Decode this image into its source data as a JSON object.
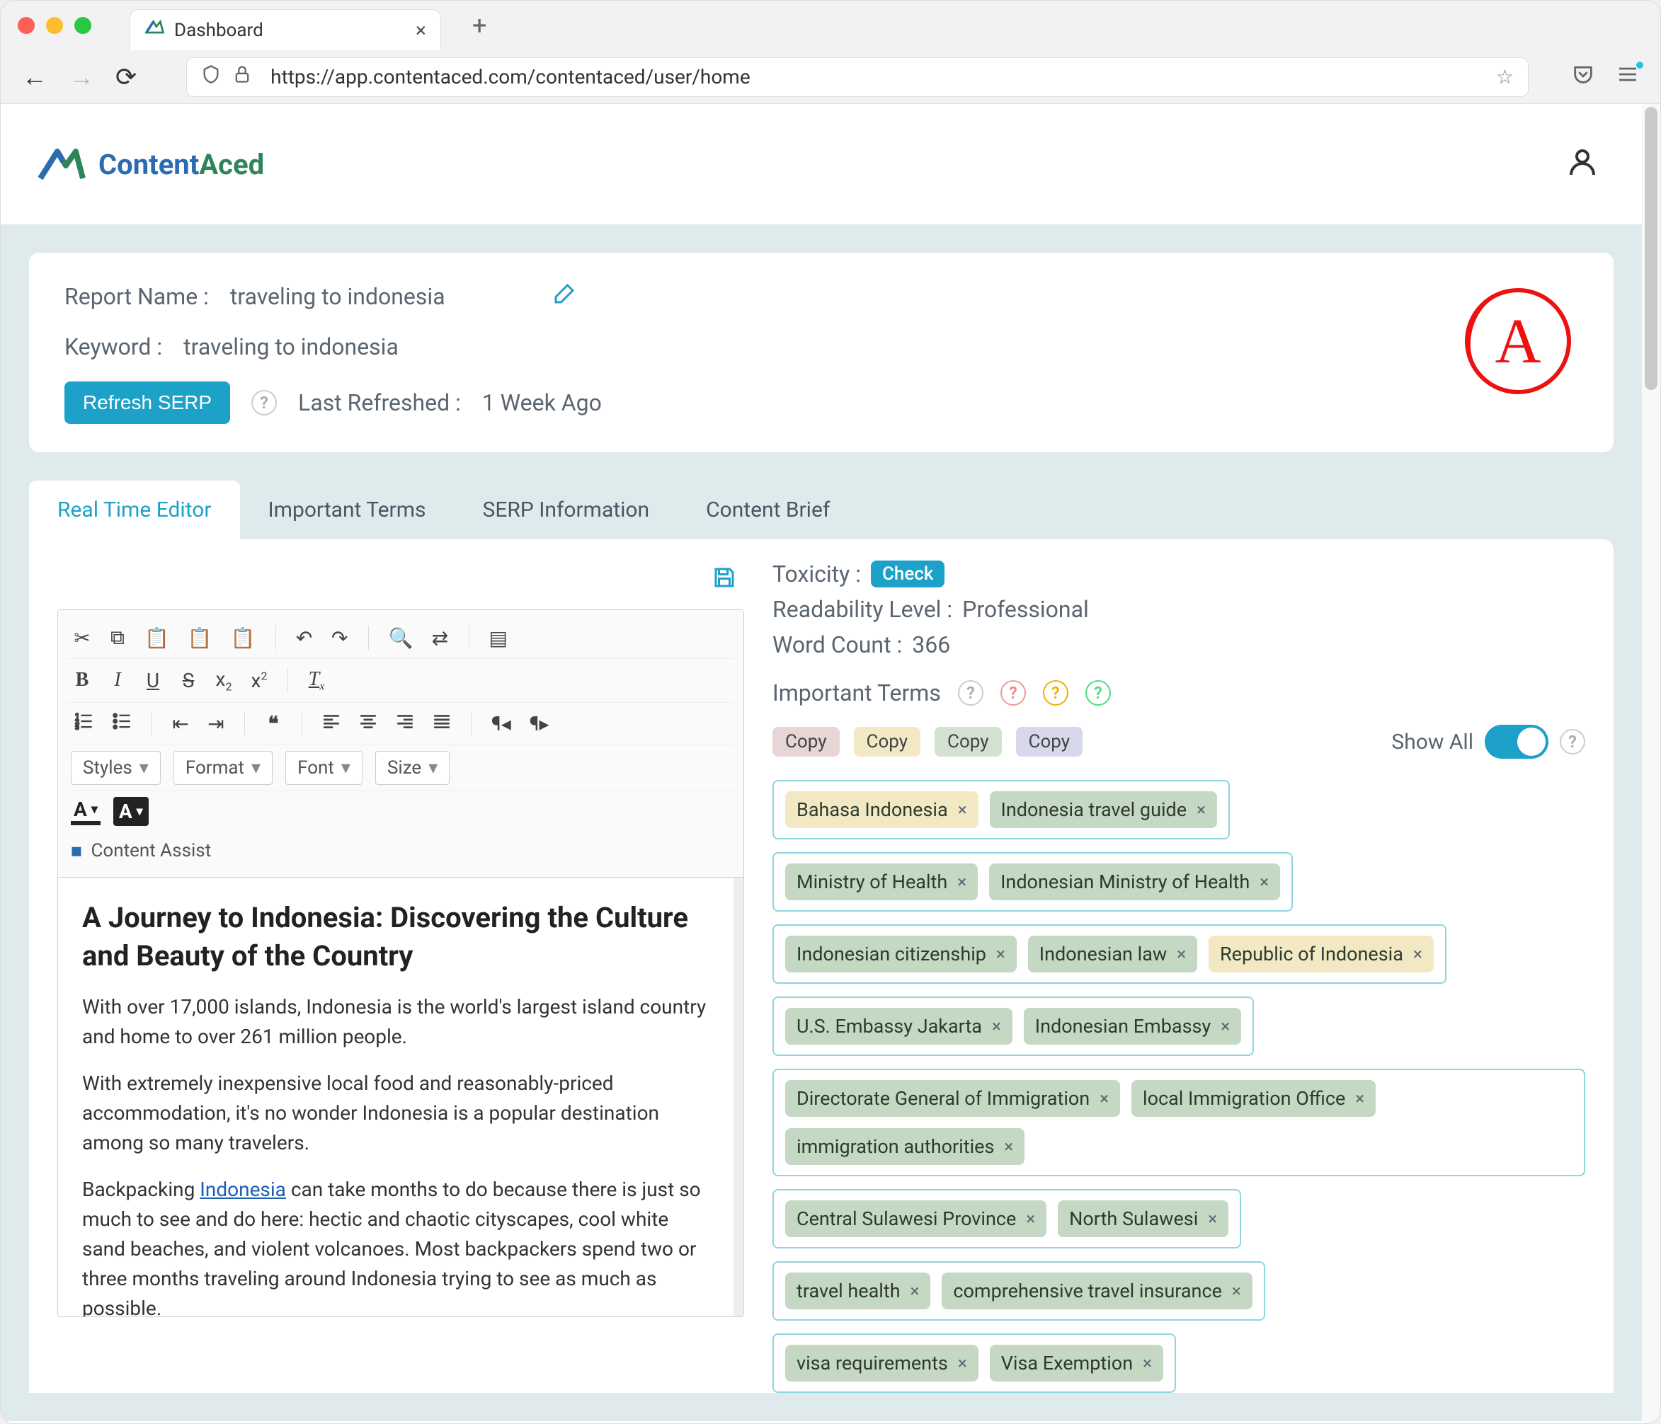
{
  "browser": {
    "tab_title": "Dashboard",
    "url": "https://app.contentaced.com/contentaced/user/home"
  },
  "brand": {
    "name_part1": "Content",
    "name_part2": "Aced"
  },
  "report": {
    "name_label": "Report Name :",
    "name_value": "traveling to indonesia",
    "keyword_label": "Keyword :",
    "keyword_value": "traveling to indonesia",
    "refresh_button": "Refresh SERP",
    "last_refreshed_label": "Last Refreshed :",
    "last_refreshed_value": "1 Week Ago",
    "grade": "A"
  },
  "tabs": {
    "editor": "Real Time Editor",
    "terms": "Important Terms",
    "serp": "SERP Information",
    "brief": "Content Brief"
  },
  "editor_toolbar": {
    "styles": "Styles",
    "format": "Format",
    "font": "Font",
    "size": "Size",
    "content_assist": "Content Assist"
  },
  "document": {
    "heading": "A Journey to Indonesia: Discovering the Culture and Beauty of the Country",
    "p1": "With over 17,000 islands, Indonesia is the world's largest island country and home to over 261 million people.",
    "p2": "With extremely inexpensive local food and reasonably-priced accommodation, it's no wonder Indonesia is a popular destination among so many travelers.",
    "p3_a": "Backpacking ",
    "p3_link": "Indonesia",
    "p3_b": " can take months to do because there is just so much to see and do here: hectic and chaotic cityscapes, cool white sand beaches, and violent volcanoes. Most backpackers spend two or three months traveling around Indonesia trying to see as much as possible."
  },
  "meta": {
    "toxicity_label": "Toxicity :",
    "toxicity_action": "Check",
    "readability_label": "Readability Level :",
    "readability_value": "Professional",
    "wordcount_label": "Word Count :",
    "wordcount_value": "366"
  },
  "terms_section": {
    "heading": "Important Terms",
    "copy_label": "Copy",
    "show_all": "Show All"
  },
  "term_groups": [
    [
      {
        "text": "Bahasa Indonesia",
        "t": "tan"
      },
      {
        "text": "Indonesia travel guide",
        "t": "green"
      }
    ],
    [
      {
        "text": "Ministry of Health",
        "t": "green"
      },
      {
        "text": "Indonesian Ministry of Health",
        "t": "green"
      }
    ],
    [
      {
        "text": "Indonesian citizenship",
        "t": "green"
      },
      {
        "text": "Indonesian law",
        "t": "green"
      },
      {
        "text": "Republic of Indonesia",
        "t": "tan"
      }
    ],
    [
      {
        "text": "U.S. Embassy Jakarta",
        "t": "green"
      },
      {
        "text": "Indonesian Embassy",
        "t": "green"
      }
    ],
    [
      {
        "text": "Directorate General of Immigration",
        "t": "green"
      },
      {
        "text": "local Immigration Office",
        "t": "green"
      },
      {
        "text": "immigration authorities",
        "t": "green"
      }
    ],
    [
      {
        "text": "Central Sulawesi Province",
        "t": "green"
      },
      {
        "text": "North Sulawesi",
        "t": "green"
      }
    ],
    [
      {
        "text": "travel health",
        "t": "green"
      },
      {
        "text": "comprehensive travel insurance",
        "t": "green"
      }
    ],
    [
      {
        "text": "visa requirements",
        "t": "green"
      },
      {
        "text": "Visa Exemption",
        "t": "green"
      }
    ]
  ]
}
